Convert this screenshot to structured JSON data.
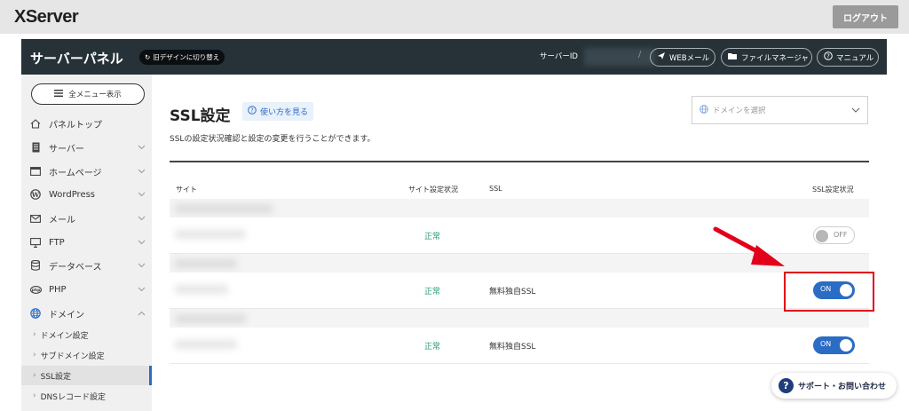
{
  "topbar": {
    "logo": "XServer",
    "logout_label": "ログアウト"
  },
  "header": {
    "panel_title": "サーバーパネル",
    "old_design_label": "旧デザインに切り替え",
    "server_id_label": "サーバーID",
    "separator": "/",
    "webmail_label": "WEBメール",
    "filemanager_label": "ファイルマネージャ",
    "manual_label": "マニュアル"
  },
  "sidebar": {
    "menu_button_label": "全メニュー表示",
    "items": [
      {
        "label": "パネルトップ",
        "icon": "home-icon"
      },
      {
        "label": "サーバー",
        "icon": "server-icon"
      },
      {
        "label": "ホームページ",
        "icon": "browser-icon"
      },
      {
        "label": "WordPress",
        "icon": "wordpress-icon"
      },
      {
        "label": "メール",
        "icon": "mail-icon"
      },
      {
        "label": "FTP",
        "icon": "monitor-icon"
      },
      {
        "label": "データベース",
        "icon": "database-icon"
      },
      {
        "label": "PHP",
        "icon": "php-icon"
      },
      {
        "label": "ドメイン",
        "icon": "globe-icon"
      }
    ],
    "sub_items": [
      {
        "label": "ドメイン設定"
      },
      {
        "label": "サブドメイン設定"
      },
      {
        "label": "SSL設定"
      },
      {
        "label": "DNSレコード設定"
      }
    ],
    "active_sub_item": "SSL設定"
  },
  "main": {
    "page_title": "SSL設定",
    "howto_label": "使い方を見る",
    "description": "SSLの設定状況確認と設定の変更を行うことができます。",
    "domain_select_placeholder": "ドメインを選択",
    "table": {
      "headers": {
        "site": "サイト",
        "site_status": "サイト設定状況",
        "ssl": "SSL",
        "ssl_status": "SSL設定状況"
      },
      "rows": [
        {
          "status": "正常",
          "ssl": "",
          "toggle": "OFF"
        },
        {
          "status": "正常",
          "ssl": "無料独自SSL",
          "toggle": "ON"
        },
        {
          "status": "正常",
          "ssl": "無料独自SSL",
          "toggle": "ON"
        }
      ]
    }
  },
  "support_label": "サポート・お問い合わせ",
  "colors": {
    "accent": "#2b6cc4",
    "header_bg": "#263238",
    "status_green": "#2a9a78",
    "highlight_red": "#e3001b"
  }
}
